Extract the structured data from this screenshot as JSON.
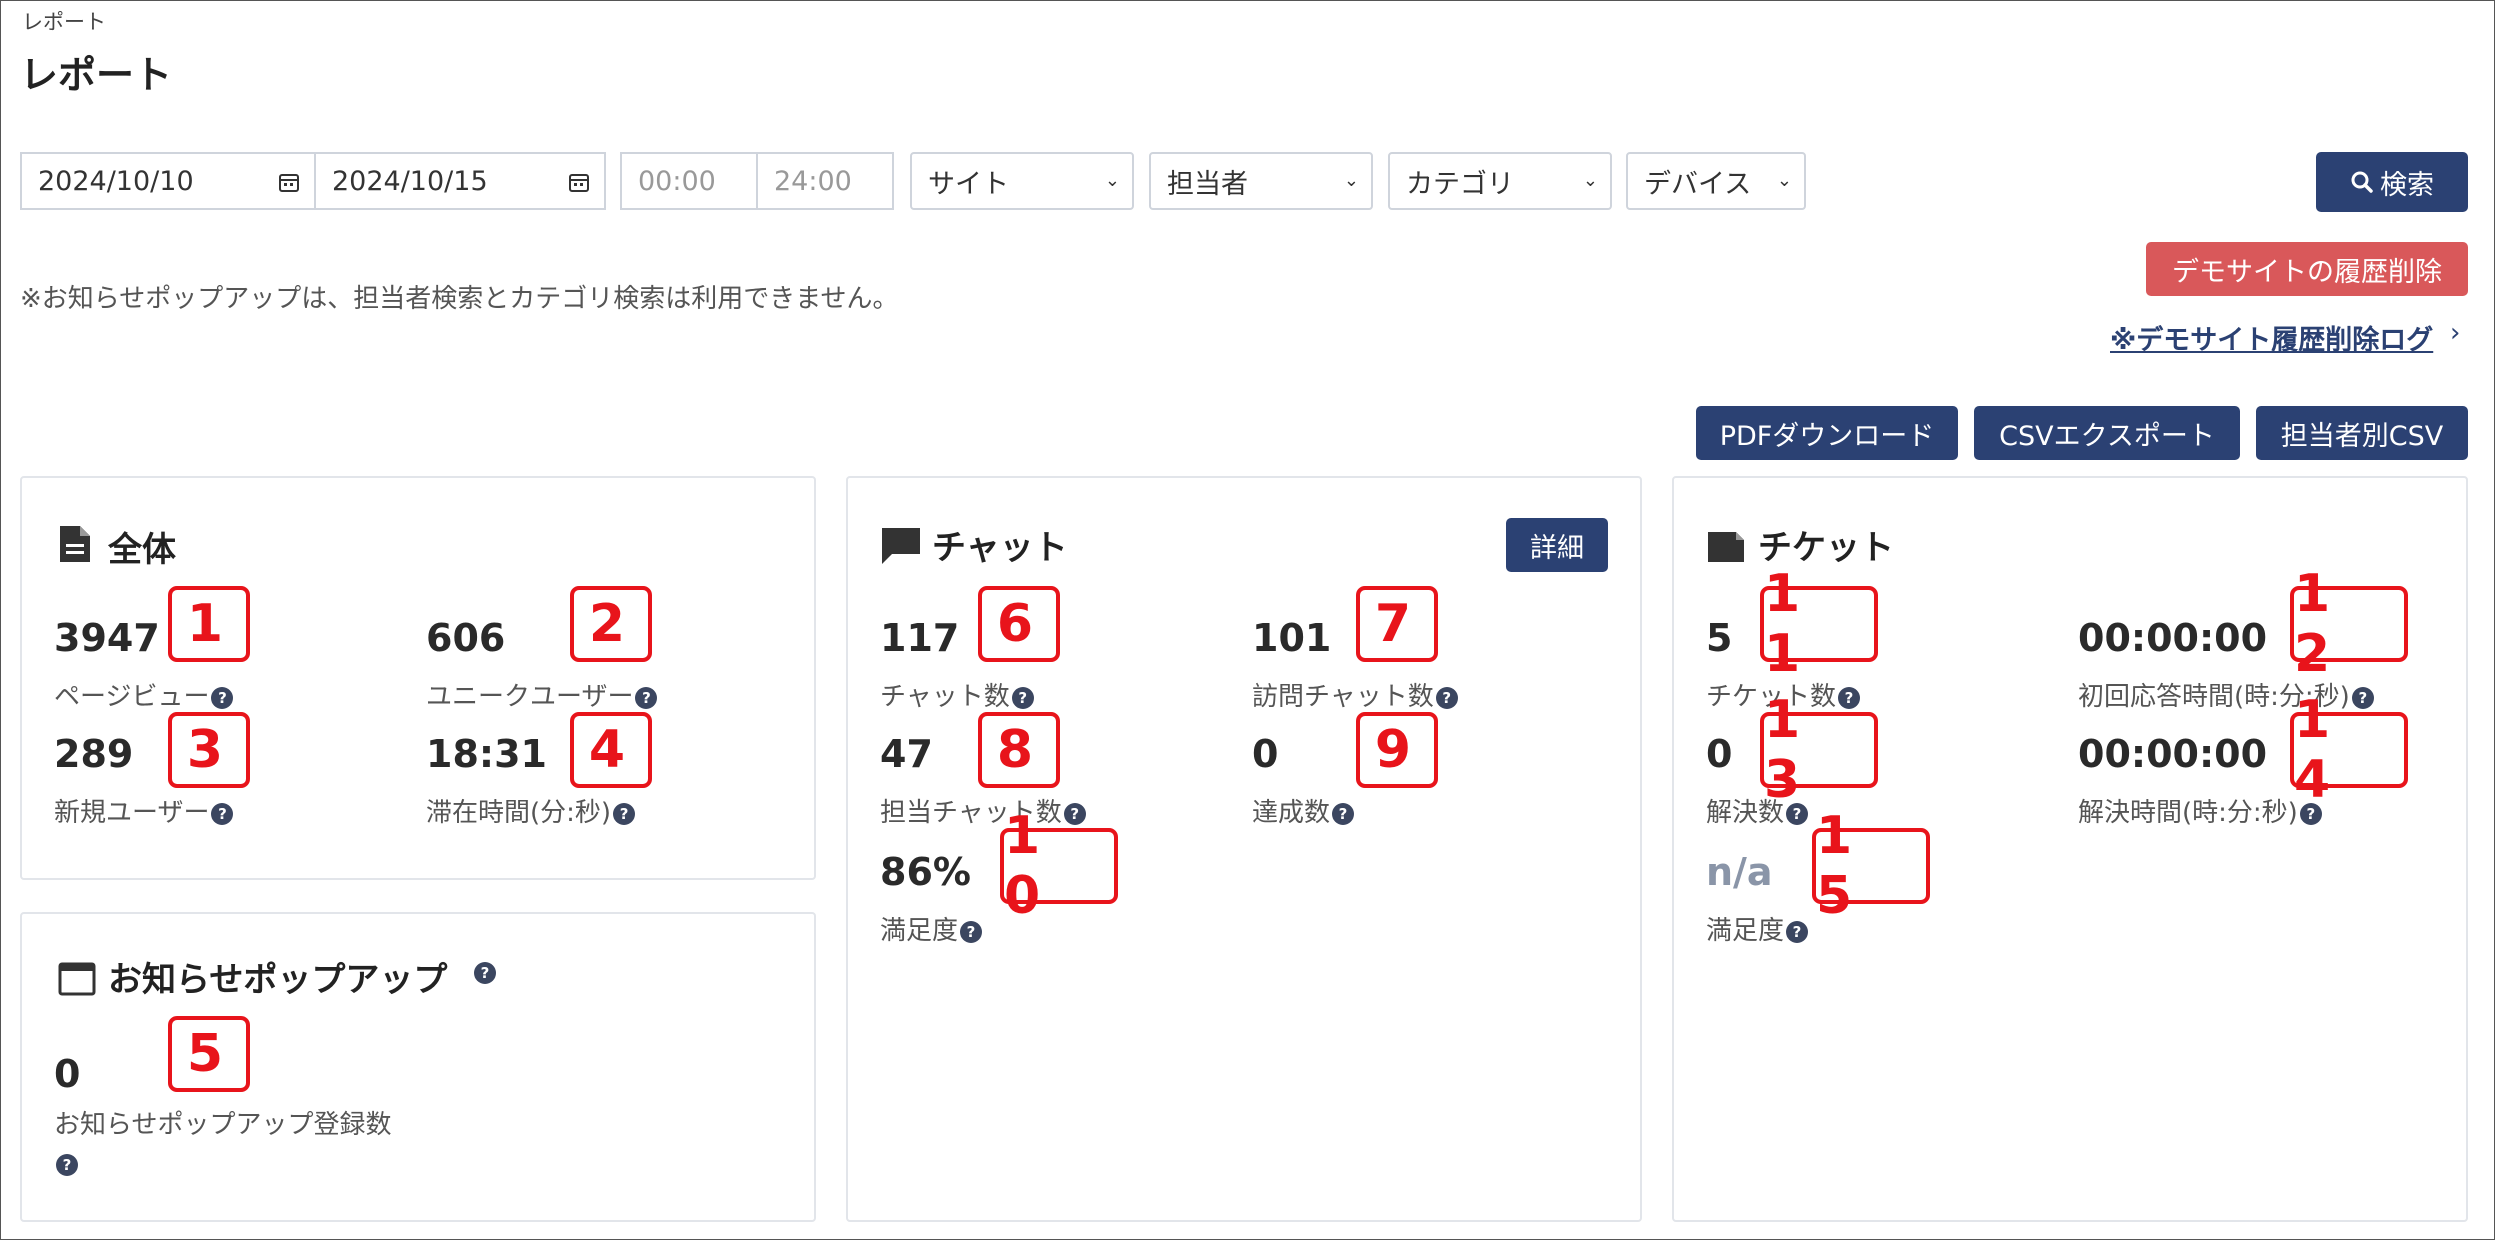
{
  "breadcrumb": "レポート",
  "page_title": "レポート",
  "filters": {
    "date_from": "2024/10/10",
    "date_to": "2024/10/15",
    "time_from": "00:00",
    "time_to": "24:00",
    "site": "サイト",
    "staff": "担当者",
    "category": "カテゴリ",
    "device": "デバイス",
    "search_label": "検索"
  },
  "note": "※お知らせポップアップは、担当者検索とカテゴリ検索は利用できません。",
  "demo": {
    "delete_button": "デモサイトの履歴削除",
    "log_link": "※デモサイト履歴削除ログ"
  },
  "export": {
    "pdf": "PDFダウンロード",
    "csv": "CSVエクスポート",
    "staff_csv": "担当者別CSV"
  },
  "overall": {
    "title": "全体",
    "pageviews": {
      "value": "3947",
      "label": "ページビュー",
      "mark": "1"
    },
    "unique_users": {
      "value": "606",
      "label": "ユニークユーザー",
      "mark": "2"
    },
    "new_users": {
      "value": "289",
      "label": "新規ユーザー",
      "mark": "3"
    },
    "stay_time": {
      "value": "18:31",
      "label": "滞在時間(分:秒)",
      "mark": "4"
    }
  },
  "popup": {
    "title": "お知らせポップアップ",
    "count": {
      "value": "0",
      "label": "お知らせポップアップ登録数",
      "mark": "5"
    }
  },
  "chat": {
    "title": "チャット",
    "detail_button": "詳細",
    "chats": {
      "value": "117",
      "label": "チャット数",
      "mark": "6"
    },
    "visit_chats": {
      "value": "101",
      "label": "訪問チャット数",
      "mark": "7"
    },
    "staff_chats": {
      "value": "47",
      "label": "担当チャット数",
      "mark": "8"
    },
    "achievements": {
      "value": "0",
      "label": "達成数",
      "mark": "9"
    },
    "satisfaction": {
      "value": "86%",
      "label": "満足度",
      "mark": "1 0"
    }
  },
  "ticket": {
    "title": "チケット",
    "tickets": {
      "value": "5",
      "label": "チケット数",
      "mark": "1 1"
    },
    "first_response": {
      "value": "00:00:00",
      "label": "初回応答時間(時:分:秒)",
      "mark": "1 2"
    },
    "resolved": {
      "value": "0",
      "label": "解決数",
      "mark": "1 3"
    },
    "resolve_time": {
      "value": "00:00:00",
      "label": "解決時間(時:分:秒)",
      "mark": "1 4"
    },
    "satisfaction": {
      "value": "n/a",
      "label": "満足度",
      "mark": "1 5"
    }
  },
  "colors": {
    "primary": "#2b4173",
    "danger": "#d9585a",
    "annotation": "#e8141b"
  }
}
